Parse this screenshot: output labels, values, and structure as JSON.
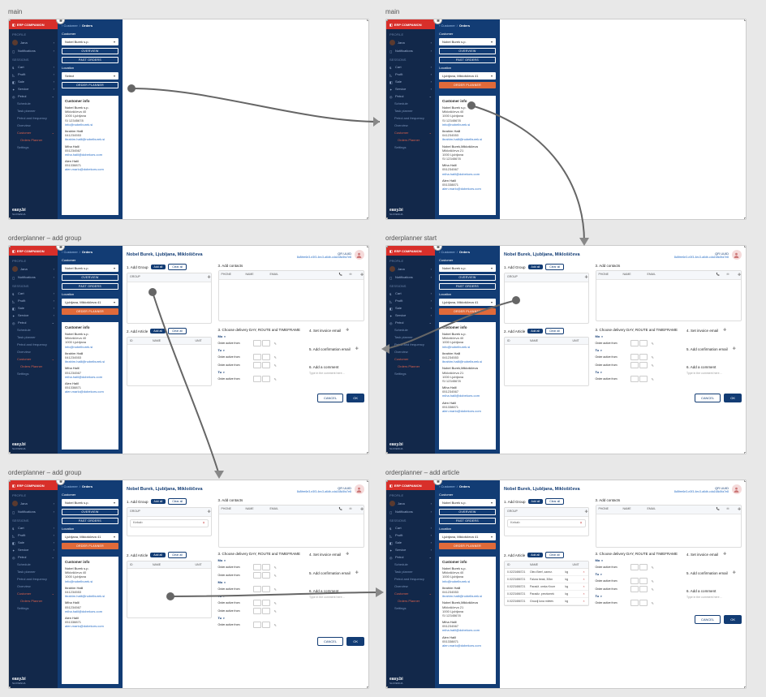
{
  "frames": {
    "main1": "main",
    "main2": "main",
    "addgroup1": "orderplanner – add group",
    "start": "orderplanner start",
    "addgroup2": "orderplanner – add group",
    "addarticle": "orderplanner – add article"
  },
  "brand": "ERP COMPANION",
  "footer_brand": "easy.bi",
  "footer_sub": "SLOVENIJA",
  "sidebar": {
    "profile_title": "PROFILE",
    "user_name": "Jana",
    "notifications": "Notifications",
    "session_title": "SESSIONS",
    "items": [
      "Cart",
      "Profit",
      "Sale",
      "Service",
      "Petrol"
    ],
    "petrol_sub": [
      "Schedule",
      "Task planner",
      "Petrol and frequency",
      "Overview",
      "Customer"
    ],
    "customer_sub": [
      "Orders Planner"
    ],
    "settings": "Settings"
  },
  "panel": {
    "breadcrumb_a": "Customer",
    "breadcrumb_b": "Orders",
    "customer_label": "Customer",
    "customer_value": "Nobel Burek s.p.",
    "overview_btn": "OVERVIEW",
    "past_btn": "PAST ORDERS",
    "location_label": "Location",
    "location_placeholder": "Select",
    "location_value": "Ljubljana, Miklošičeva 41",
    "planner_btn": "ORDER PLANNER"
  },
  "customer_info": {
    "title": "Customer info",
    "block1": [
      "Nobel Burek s.p.",
      "Miklošičeva 40",
      "1000 Ljubljana",
      "SI 12345678",
      "info@nobelburek.si"
    ],
    "block2": [
      "Ibrahim Halil",
      "041234553",
      "ibrahim.halil@nobelburek.si"
    ],
    "block2b": [
      "Nobel Burek,Miklošičeva",
      "Miklošičeva 21",
      "1000 Ljubljana",
      "SI 12345678"
    ],
    "block3": [
      "Miha Halil",
      "051234567",
      "miha.halil@dobekors.com"
    ],
    "block4": [
      "Alen Halil",
      "051338871",
      "alen.marlo@dobekors.com"
    ]
  },
  "planner": {
    "title": "Nobel Burek, Ljubljana, Miklošičeva",
    "qr_label": "QR UUID",
    "qr_value": "8c8fee6e3-e3f3-4ec3-a6db-cda168c5fa7e8",
    "s1": "1. Add Group",
    "add_all": "Add all",
    "clear_all": "Clear all",
    "group_col": "GROUP",
    "group_placeholder": "Kebab",
    "s2": "2. Add Article",
    "article_cols": [
      "ID",
      "NAME",
      "UNIT"
    ],
    "articles": [
      {
        "id": "0.0223456721",
        "name": "Oleo Beef, zamrz.",
        "unit": "kg"
      },
      {
        "id": "0.0223456721",
        "name": "Falura beak, 30kn",
        "unit": "kg"
      },
      {
        "id": "0.0223456721",
        "name": "Paradž. omka Knorr",
        "unit": "kg"
      },
      {
        "id": "0.0223456721",
        "name": "Paradiz. prevlomek",
        "unit": "kg"
      },
      {
        "id": "0.0223456721",
        "name": "Grozdj luna mletev",
        "unit": "kg"
      }
    ],
    "s3": "3. Add contacts",
    "contact_cols": [
      "PHONE",
      "NAME",
      "EMAIL"
    ],
    "icons": {
      "phone_header": "☎",
      "sms_header": "✉"
    },
    "s4": "3. Choose delivery DAY, ROUTE and TIMEFRAME",
    "day_mo": "Mo",
    "day_tu": "Tu",
    "active_from": "Order active from",
    "s5": "4. Set invoice email",
    "add_confirm": "5. Add confirmation email",
    "add_comment": "6. Add a comment",
    "comment_ph": "Type in the comment here…",
    "cancel": "CANCEL",
    "ok": "OK"
  }
}
